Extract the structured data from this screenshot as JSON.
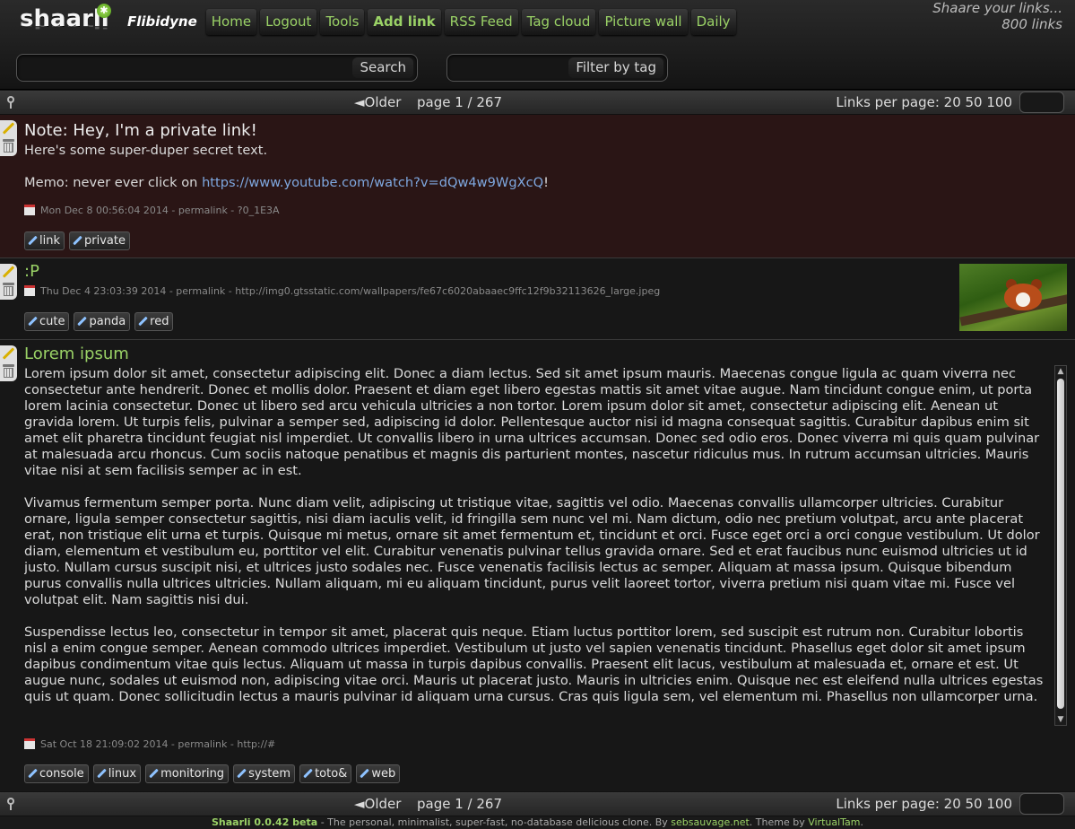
{
  "header": {
    "logo_text": "shaarli",
    "menu": {
      "brand": "Flibidyne",
      "home": "Home",
      "logout": "Logout",
      "tools": "Tools",
      "add_link": "Add link",
      "rss": "RSS Feed",
      "tag_cloud": "Tag cloud",
      "picture_wall": "Picture wall",
      "daily": "Daily"
    },
    "stats": {
      "line1": "Shaare your links...",
      "line2": "800 links"
    },
    "search": {
      "value": "",
      "button": "Search"
    },
    "tag_filter": {
      "value": "",
      "button": "Filter by tag"
    }
  },
  "paging": {
    "older": "◄Older",
    "page": "page 1 / 267",
    "links_per_page": "Links per page: 20 50 100",
    "custom_value": ""
  },
  "links": [
    {
      "title": "Note: Hey, I'm a private link!",
      "desc_line1": "Here's some super-duper secret text.",
      "memo_prefix": "Memo: never ever click on ",
      "memo_url": "https://www.youtube.com/watch?v=dQw4w9WgXcQ",
      "memo_suffix": "!",
      "meta": "Mon Dec 8 00:56:04 2014 - permalink - ?0_1E3A",
      "tags": [
        "link",
        "private"
      ]
    },
    {
      "title": ":P",
      "meta": "Thu Dec 4 23:03:39 2014 - permalink - http://img0.gtsstatic.com/wallpapers/fe67c6020abaaec9ffc12f9b32113626_large.jpeg",
      "tags": [
        "cute",
        "panda",
        "red"
      ]
    },
    {
      "title": "Lorem ipsum",
      "para1": "Lorem ipsum dolor sit amet, consectetur adipiscing elit. Donec a diam lectus. Sed sit amet ipsum mauris. Maecenas congue ligula ac quam viverra nec consectetur ante hendrerit. Donec et mollis dolor. Praesent et diam eget libero egestas mattis sit amet vitae augue. Nam tincidunt congue enim, ut porta lorem lacinia consectetur. Donec ut libero sed arcu vehicula ultricies a non tortor. Lorem ipsum dolor sit amet, consectetur adipiscing elit. Aenean ut gravida lorem. Ut turpis felis, pulvinar a semper sed, adipiscing id dolor. Pellentesque auctor nisi id magna consequat sagittis. Curabitur dapibus enim sit amet elit pharetra tincidunt feugiat nisl imperdiet. Ut convallis libero in urna ultrices accumsan. Donec sed odio eros. Donec viverra mi quis quam pulvinar at malesuada arcu rhoncus. Cum sociis natoque penatibus et magnis dis parturient montes, nascetur ridiculus mus. In rutrum accumsan ultricies. Mauris vitae nisi at sem facilisis semper ac in est.",
      "para2": "Vivamus fermentum semper porta. Nunc diam velit, adipiscing ut tristique vitae, sagittis vel odio. Maecenas convallis ullamcorper ultricies. Curabitur ornare, ligula semper consectetur sagittis, nisi diam iaculis velit, id fringilla sem nunc vel mi. Nam dictum, odio nec pretium volutpat, arcu ante placerat erat, non tristique elit urna et turpis. Quisque mi metus, ornare sit amet fermentum et, tincidunt et orci. Fusce eget orci a orci congue vestibulum. Ut dolor diam, elementum et vestibulum eu, porttitor vel elit. Curabitur venenatis pulvinar tellus gravida ornare. Sed et erat faucibus nunc euismod ultricies ut id justo. Nullam cursus suscipit nisi, et ultrices justo sodales nec. Fusce venenatis facilisis lectus ac semper. Aliquam at massa ipsum. Quisque bibendum purus convallis nulla ultrices ultricies. Nullam aliquam, mi eu aliquam tincidunt, purus velit laoreet tortor, viverra pretium nisi quam vitae mi. Fusce vel volutpat elit. Nam sagittis nisi dui.",
      "para3": "Suspendisse lectus leo, consectetur in tempor sit amet, placerat quis neque. Etiam luctus porttitor lorem, sed suscipit est rutrum non. Curabitur lobortis nisl a enim congue semper. Aenean commodo ultrices imperdiet. Vestibulum ut justo vel sapien venenatis tincidunt. Phasellus eget dolor sit amet ipsum dapibus condimentum vitae quis lectus. Aliquam ut massa in turpis dapibus convallis. Praesent elit lacus, vestibulum at malesuada et, ornare et est. Ut augue nunc, sodales ut euismod non, adipiscing vitae orci. Mauris ut placerat justo. Mauris in ultricies enim. Quisque nec est eleifend nulla ultrices egestas quis ut quam. Donec sollicitudin lectus a mauris pulvinar id aliquam urna cursus. Cras quis ligula sem, vel elementum mi. Phasellus non ullamcorper urna.",
      "meta": "Sat Oct 18 21:09:02 2014 - permalink - http://#",
      "tags": [
        "console",
        "linux",
        "monitoring",
        "system",
        "toto&",
        "web"
      ]
    }
  ],
  "footer": {
    "name": "Shaarli 0.0.42 beta",
    "text1": " - The personal, minimalist, super-fast, no-database delicious clone. By ",
    "author": "sebsauvage.net",
    "text2": ". Theme by ",
    "theme": "VirtualTam",
    "text3": "."
  },
  "colors": {
    "accent": "#9ad266",
    "private_bg": "#2a1515",
    "link_url": "#7fa8e0"
  }
}
